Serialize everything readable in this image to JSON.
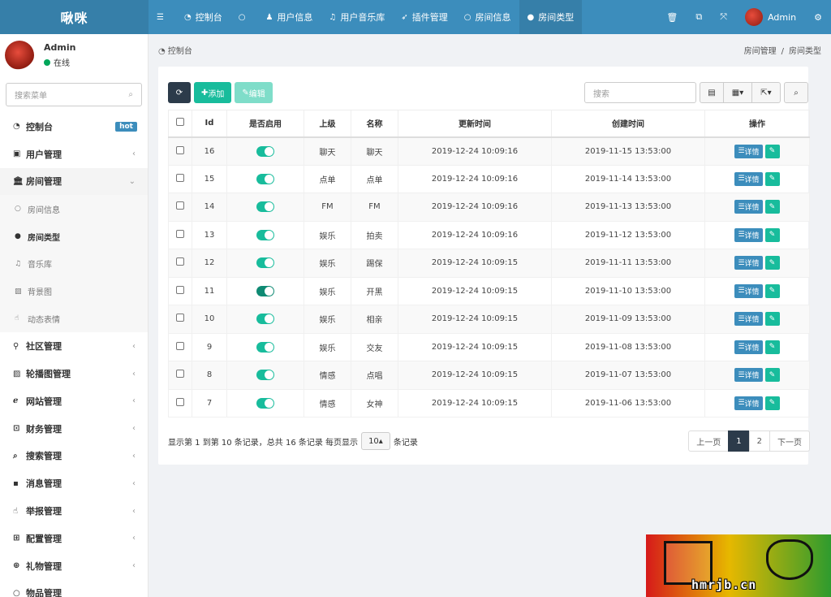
{
  "app": {
    "title": "啾咪"
  },
  "topnav": [
    {
      "label": "",
      "icon": "menu-icon"
    },
    {
      "label": "控制台",
      "icon": "dashboard-icon"
    },
    {
      "label": "",
      "icon": "circle-icon"
    },
    {
      "label": "用户信息",
      "icon": "user-icon"
    },
    {
      "label": "用户音乐库",
      "icon": "music-icon"
    },
    {
      "label": "插件管理",
      "icon": "rocket-icon"
    },
    {
      "label": "房间信息",
      "icon": "circle-icon"
    },
    {
      "label": "房间类型",
      "icon": "dot-icon"
    }
  ],
  "topright": {
    "user": "Admin"
  },
  "user": {
    "name": "Admin",
    "status": "在线"
  },
  "sidebar_search": {
    "placeholder": "搜索菜单"
  },
  "menu": {
    "dashboard": "控制台",
    "hot": "hot",
    "user_mgmt": "用户管理",
    "room_mgmt": "房间管理",
    "room_info": "房间信息",
    "room_type": "房间类型",
    "music": "音乐库",
    "bg": "背景图",
    "emoji": "动态表情",
    "community": "社区管理",
    "carousel": "轮播图管理",
    "site": "网站管理",
    "finance": "财务管理",
    "search": "搜索管理",
    "message": "消息管理",
    "report": "举报管理",
    "config": "配置管理",
    "gift": "礼物管理",
    "goods": "物品管理"
  },
  "breadcrumb": {
    "home": "控制台",
    "level1": "房间管理",
    "level2": "房间类型"
  },
  "toolbar": {
    "add": "添加",
    "edit": "编辑",
    "search_placeholder": "搜索"
  },
  "table": {
    "headers": {
      "id": "Id",
      "enabled": "是否启用",
      "parent": "上级",
      "name": "名称",
      "updated": "更新时间",
      "created": "创建时间",
      "ops": "操作"
    },
    "detail_label": "详情",
    "rows": [
      {
        "id": "16",
        "enabled": true,
        "parent": "聊天",
        "name": "聊天",
        "updated": "2019-12-24 10:09:16",
        "created": "2019-11-15 13:53:00"
      },
      {
        "id": "15",
        "enabled": true,
        "parent": "点单",
        "name": "点单",
        "updated": "2019-12-24 10:09:16",
        "created": "2019-11-14 13:53:00"
      },
      {
        "id": "14",
        "enabled": true,
        "parent": "FM",
        "name": "FM",
        "updated": "2019-12-24 10:09:16",
        "created": "2019-11-13 13:53:00"
      },
      {
        "id": "13",
        "enabled": true,
        "parent": "娱乐",
        "name": "拍卖",
        "updated": "2019-12-24 10:09:16",
        "created": "2019-11-12 13:53:00"
      },
      {
        "id": "12",
        "enabled": true,
        "parent": "娱乐",
        "name": "踢保",
        "updated": "2019-12-24 10:09:15",
        "created": "2019-11-11 13:53:00"
      },
      {
        "id": "11",
        "enabled": true,
        "parent": "娱乐",
        "name": "开黑",
        "updated": "2019-12-24 10:09:15",
        "created": "2019-11-10 13:53:00"
      },
      {
        "id": "10",
        "enabled": true,
        "parent": "娱乐",
        "name": "相亲",
        "updated": "2019-12-24 10:09:15",
        "created": "2019-11-09 13:53:00"
      },
      {
        "id": "9",
        "enabled": true,
        "parent": "娱乐",
        "name": "交友",
        "updated": "2019-12-24 10:09:15",
        "created": "2019-11-08 13:53:00"
      },
      {
        "id": "8",
        "enabled": true,
        "parent": "情感",
        "name": "点唱",
        "updated": "2019-12-24 10:09:15",
        "created": "2019-11-07 13:53:00"
      },
      {
        "id": "7",
        "enabled": true,
        "parent": "情感",
        "name": "女神",
        "updated": "2019-12-24 10:09:15",
        "created": "2019-11-06 13:53:00"
      }
    ]
  },
  "footer": {
    "info_prefix": "显示第 1 到第 10 条记录，总共 16 条记录 每页显示",
    "page_size": "10",
    "info_suffix": "条记录"
  },
  "pager": {
    "prev": "上一页",
    "p1": "1",
    "p2": "2",
    "next": "下一页"
  },
  "watermark": {
    "text": "hmrjb.cn"
  },
  "colors": {
    "topbar": "#3c8dbc",
    "accent_green": "#18bc9c",
    "dark": "#2c3b4a"
  }
}
